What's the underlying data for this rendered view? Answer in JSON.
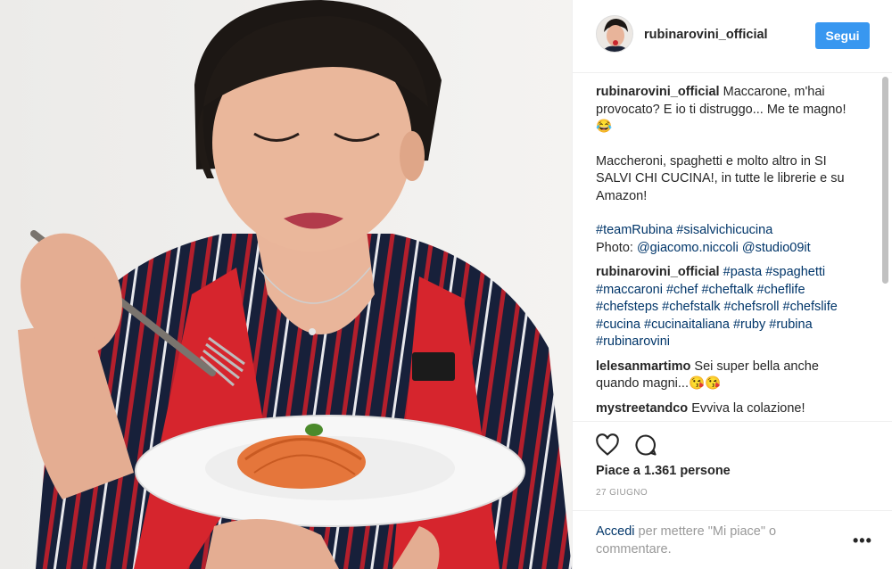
{
  "post": {
    "username": "rubinarovini_official",
    "follow_label": "Segui",
    "caption": {
      "user": "rubinarovini_official",
      "line1": "Maccarone, m'hai provocato? E io ti distruggo... Me te magno! 😂",
      "line2": "Maccheroni, spaghetti e molto altro in SI SALVI CHI CUCINA!, in tutte le librerie e su Amazon!",
      "tags_line": "#teamRubina #sisalvichicucina",
      "photo_prefix": "Photo: ",
      "photo_mention1": "@giacomo.niccoli",
      "photo_mention2": "@studio09it"
    },
    "comments": [
      {
        "user": "rubinarovini_official",
        "text": "#pasta #spaghetti #maccaroni #chef #cheftalk #cheflife #chefsteps #chefstalk #chefsroll #chefslife #cucina #cucinaitaliana #ruby #rubina #rubinarovini"
      },
      {
        "user": "lelesanmartimo",
        "text": "Sei super bella anche quando magni...😘😘"
      },
      {
        "user": "mystreetandco",
        "text": "Evviva la colazione!"
      }
    ],
    "likes_text": "Piace a 1.361 persone",
    "date": "27 GIUGNO",
    "login_link": "Accedi",
    "login_rest": " per mettere \"Mi piace\" o commentare.",
    "more_label": "•••"
  },
  "icons": {
    "like": "heart-icon",
    "comment": "comment-icon",
    "more": "more-options-icon"
  },
  "colors": {
    "follow_button": "#3897f0",
    "link": "#003569",
    "secondary_text": "#999999"
  }
}
